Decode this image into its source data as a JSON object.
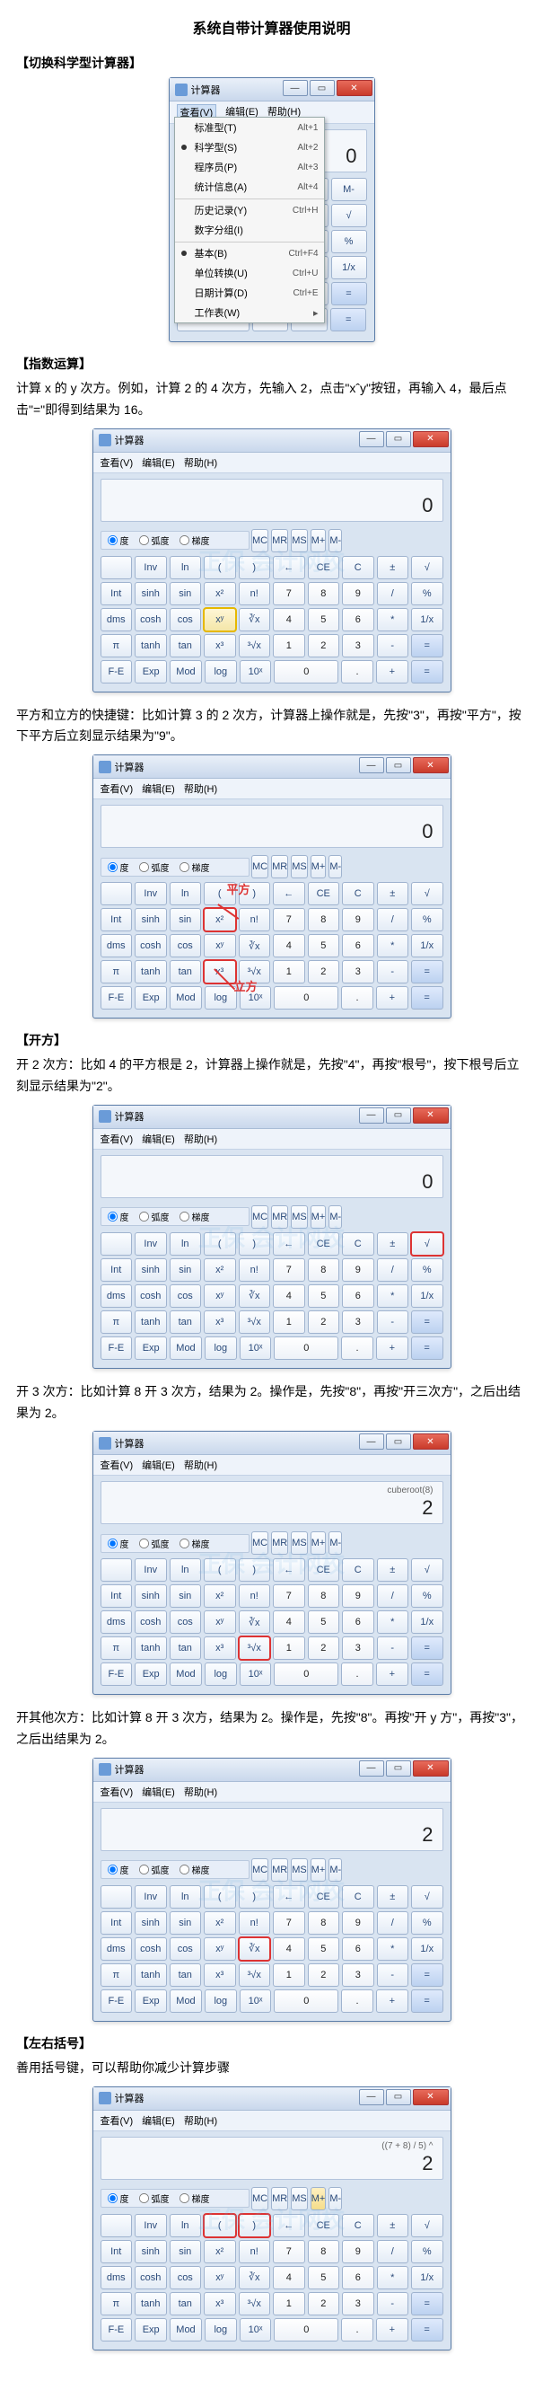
{
  "doc": {
    "title": "系统自带计算器使用说明",
    "sections": {
      "switch": {
        "heading": "【切换科学型计算器】"
      },
      "power": {
        "heading": "【指数运算】",
        "p1": "计算 x 的 y 次方。例如，计算 2 的 4 次方，先输入 2，点击\"xˆy\"按钮，再输入 4，最后点击\"=\"即得到结果为 16。",
        "p2": "平方和立方的快捷键：比如计算 3 的 2 次方，计算器上操作就是，先按\"3\"，再按\"平方\"，按下平方后立刻显示结果为\"9\"。"
      },
      "root": {
        "heading": "【开方】",
        "p1": "开 2 次方：比如 4 的平方根是 2，计算器上操作就是，先按\"4\"，再按\"根号\"，按下根号后立刻显示结果为\"2\"。",
        "p2": "开 3 次方：比如计算 8 开 3 次方，结果为 2。操作是，先按\"8\"，再按\"开三次方\"，之后出结果为 2。",
        "p3": "开其他次方：比如计算 8 开 3 次方，结果为 2。操作是，先按\"8\"。再按\"开 y 方\"，再按\"3\"，之后出结果为 2。"
      },
      "paren": {
        "heading": "【左右括号】",
        "p1": "善用括号键，可以帮助你减少计算步骤"
      }
    },
    "anno": {
      "square": "平方",
      "cube": "立方"
    }
  },
  "watermark": "正保 会计网校  www.chinaacc.com",
  "calc": {
    "title": "计算器",
    "menu": {
      "view": "查看(V)",
      "edit": "编辑(E)",
      "help": "帮助(H)"
    },
    "view_menu": [
      {
        "label": "标准型(T)",
        "shortcut": "Alt+1"
      },
      {
        "label": "科学型(S)",
        "shortcut": "Alt+2",
        "dot": true
      },
      {
        "label": "程序员(P)",
        "shortcut": "Alt+3"
      },
      {
        "label": "统计信息(A)",
        "shortcut": "Alt+4"
      },
      {
        "label": "历史记录(Y)",
        "shortcut": "Ctrl+H",
        "sep": true
      },
      {
        "label": "数字分组(I)"
      },
      {
        "label": "基本(B)",
        "shortcut": "Ctrl+F4",
        "sep": true,
        "dot": true
      },
      {
        "label": "单位转换(U)",
        "shortcut": "Ctrl+U"
      },
      {
        "label": "日期计算(D)",
        "shortcut": "Ctrl+E"
      },
      {
        "label": "工作表(W)",
        "arrow": true
      }
    ],
    "radio": {
      "deg": "度",
      "rad": "弧度",
      "grad": "梯度"
    },
    "mem": [
      "MC",
      "MR",
      "MS",
      "M+",
      "M-"
    ],
    "top": [
      "←",
      "CE",
      "C",
      "±",
      "√"
    ],
    "sci_col": [
      [
        "",
        "Inv",
        "ln",
        "(",
        ")"
      ],
      [
        "Int",
        "sinh",
        "sin",
        "x²",
        "n!"
      ],
      [
        "dms",
        "cosh",
        "cos",
        "xʸ",
        "∛x"
      ],
      [
        "π",
        "tanh",
        "tan",
        "x³",
        "³√x"
      ],
      [
        "F-E",
        "Exp",
        "Mod",
        "log",
        "10ˣ"
      ]
    ],
    "num_rows": [
      [
        "7",
        "8",
        "9",
        "/",
        "%"
      ],
      [
        "4",
        "5",
        "6",
        "*",
        "1/x"
      ],
      [
        "1",
        "2",
        "3",
        "-",
        "="
      ],
      [
        "0",
        "",
        ".",
        "+",
        ""
      ]
    ],
    "displays": {
      "d0": "0",
      "cuberoot_sub": "cuberoot(8)",
      "cuberoot_main": "2",
      "paren_sub": "((7 + 8) / 5) ^",
      "paren_main": "2"
    }
  }
}
